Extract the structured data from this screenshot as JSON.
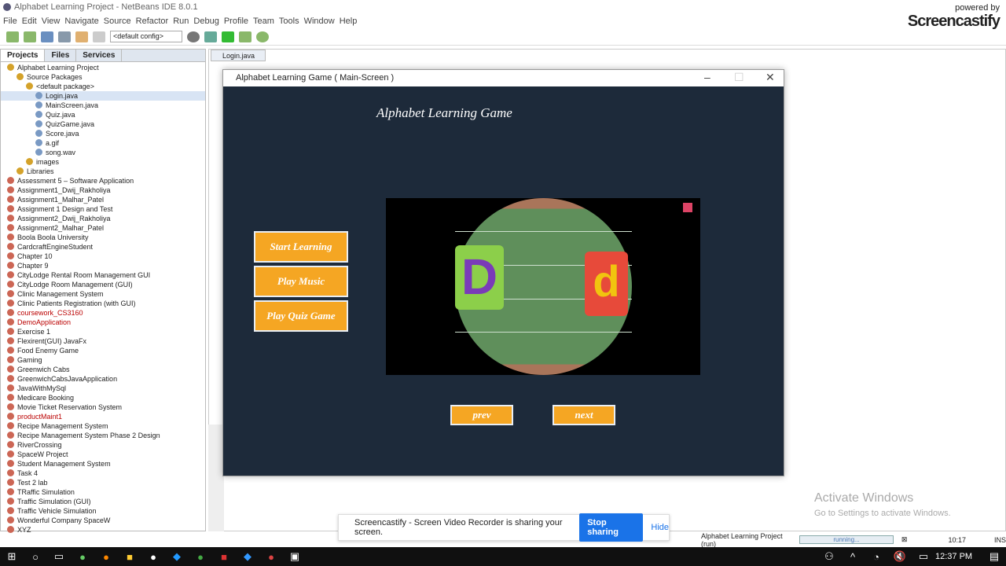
{
  "window_title": "Alphabet Learning Project - NetBeans IDE 8.0.1",
  "menu": [
    "File",
    "Edit",
    "View",
    "Navigate",
    "Source",
    "Refactor",
    "Run",
    "Debug",
    "Profile",
    "Team",
    "Tools",
    "Window",
    "Help"
  ],
  "toolbar": {
    "config": "<default config>"
  },
  "branding": {
    "powered": "powered by",
    "name": "Screencastify"
  },
  "panel_tabs": [
    "Projects",
    "Files",
    "Services"
  ],
  "tree": [
    "Alphabet Learning Project",
    "Source Packages",
    "<default package>",
    "Login.java",
    "MainScreen.java",
    "Quiz.java",
    "QuizGame.java",
    "Score.java",
    "a.gif",
    "song.wav",
    "images",
    "Libraries"
  ],
  "projects": [
    "Assessment 5 – Software Application",
    "Assignment1_Dwij_Rakholiya",
    "Assignment1_Malhar_Patel",
    "Assignment 1  Design and Test",
    "Assignment2_Dwij_Rakholiya",
    "Assignment2_Malhar_Patel",
    "Boola Boola University",
    "CardcraftEngineStudent",
    "Chapter 10",
    "Chapter 9",
    "CityLodge Rental Room Management GUI",
    "CityLodge Room Management (GUI)",
    "Clinic Management System",
    "Clinic Patients Registration (with GUI)",
    "coursework_CS3160",
    "DemoApplication",
    "Exercise 1",
    "Flexirent(GUI) JavaFx",
    "Food Enemy Game",
    "Gaming",
    "Greenwich Cabs",
    "GreenwichCabsJavaApplication",
    "JavaWithMySql",
    "Medicare Booking",
    "Movie Ticket Reservation System",
    "productMaint1",
    "Recipe Management System",
    "Recipe Management System Phase 2 Design",
    "RiverCrossing",
    "SpaceW Project",
    "Student Management System",
    "Task 4",
    "Test 2 lab",
    "TRaffic Simulation",
    "Traffic Simulation (GUI)",
    "Traffic Vehicle Simulation",
    "Wonderful Company SpaceW",
    "XYZ"
  ],
  "editor_tab": "Login.java",
  "game": {
    "window_title": "Alphabet Learning Game ( Main-Screen )",
    "heading": "Alphabet Learning Game",
    "buttons": [
      "Start Learning",
      "Play Music",
      "Play Quiz Game"
    ],
    "prev": "prev",
    "next": "next",
    "letters": [
      "D",
      "d"
    ]
  },
  "watermark": {
    "line1": "Activate Windows",
    "line2": "Go to Settings to activate Windows."
  },
  "share": {
    "text": "Screencastify - Screen Video Recorder is sharing your screen.",
    "stop": "Stop sharing",
    "hide": "Hide"
  },
  "status": {
    "project": "Alphabet Learning Project (run)",
    "progress": "running...",
    "position": "10:17",
    "mode": "INS"
  },
  "taskbar": {
    "time": "12:37 PM"
  }
}
